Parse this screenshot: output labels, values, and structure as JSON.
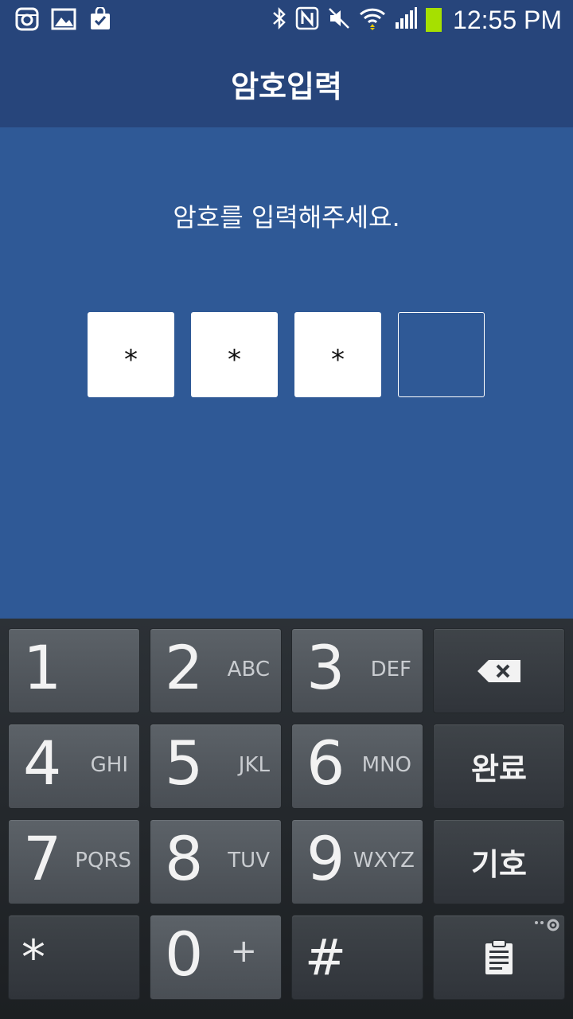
{
  "status_bar": {
    "left_icons": [
      "instagram-icon",
      "gallery-icon",
      "shopping-bag-icon"
    ],
    "right_icons": [
      "bluetooth-icon",
      "nfc-icon",
      "mute-icon",
      "wifi-icon",
      "signal-icon",
      "battery-icon"
    ],
    "time": "12:55 PM",
    "battery_color": "#a6e000"
  },
  "header": {
    "title": "암호입력"
  },
  "main": {
    "prompt": "암호를 입력해주세요.",
    "pin": {
      "entered": [
        "*",
        "*",
        "*"
      ],
      "length": 4
    }
  },
  "keypad": {
    "keys": [
      {
        "digit": "1",
        "letters": ""
      },
      {
        "digit": "2",
        "letters": "ABC"
      },
      {
        "digit": "3",
        "letters": "DEF"
      },
      {
        "digit": "4",
        "letters": "GHI"
      },
      {
        "digit": "5",
        "letters": "JKL"
      },
      {
        "digit": "6",
        "letters": "MNO"
      },
      {
        "digit": "7",
        "letters": "PQRS"
      },
      {
        "digit": "8",
        "letters": "TUV"
      },
      {
        "digit": "9",
        "letters": "WXYZ"
      },
      {
        "digit": "0",
        "letters": "+"
      }
    ],
    "star": "*",
    "hash": "#",
    "done_label": "완료",
    "symbol_label": "기호",
    "backspace_icon": "backspace-icon",
    "clipboard_icon": "clipboard-icon"
  },
  "colors": {
    "title_bar": "#27457b",
    "background": "#2f5996",
    "keypad": "#2c3136"
  }
}
